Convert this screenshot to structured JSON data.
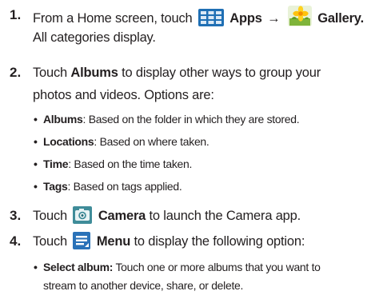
{
  "steps": [
    {
      "number": "1.",
      "text_from": "From a Home screen, touch",
      "apps_label": "Apps",
      "arrow": "→",
      "gallery_label": "Gallery",
      "line2": "All categories display."
    },
    {
      "number": "2.",
      "text_touch": "Touch",
      "albums_label": "Albums",
      "text_rest": "to display other ways to group your",
      "line2": "photos and videos. Options are:",
      "options": [
        {
          "term": "Albums",
          "desc": ": Based on the folder in which they are stored."
        },
        {
          "term": "Locations",
          "desc": ": Based on where taken."
        },
        {
          "term": "Time",
          "desc": ": Based on the time taken."
        },
        {
          "term": "Tags",
          "desc": ": Based on tags applied."
        }
      ]
    },
    {
      "number": "3.",
      "text_touch": "Touch",
      "camera_label": "Camera",
      "text_rest": "to launch the Camera app."
    },
    {
      "number": "4.",
      "text_touch": "Touch",
      "menu_label": "Menu",
      "text_rest": "to display the following option:",
      "option_term": "Select album:",
      "option_desc_line1": "Touch one or more albums that you want to",
      "option_desc_line2": "stream to another device, share, or delete."
    }
  ],
  "icons": {
    "apps": "apps-grid-icon",
    "gallery": "gallery-flower-icon",
    "camera": "camera-icon",
    "menu": "menu-icon"
  },
  "colors": {
    "text": "#231f20",
    "apps_blue": "#1f6fb4",
    "gallery_green": "#7fb43a",
    "camera_teal": "#3f8c99",
    "menu_blue": "#2a72b8"
  }
}
